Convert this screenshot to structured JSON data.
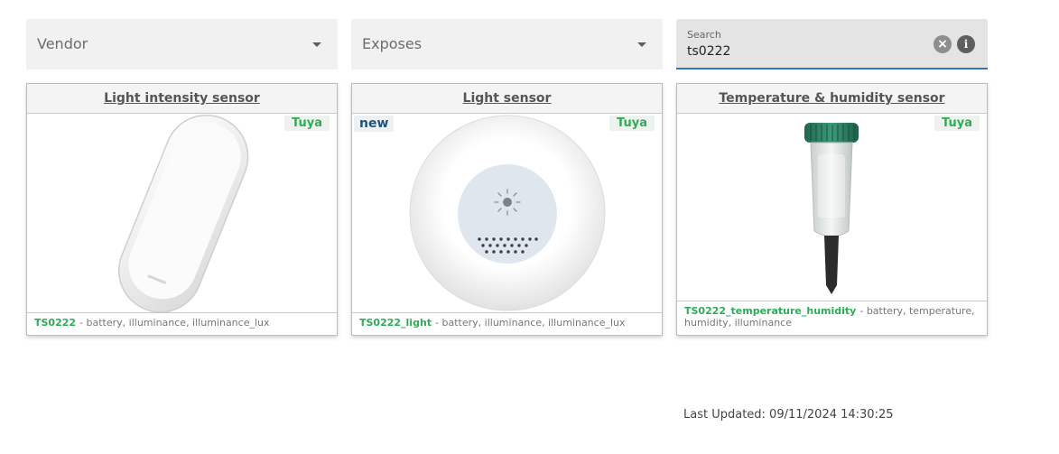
{
  "filters": {
    "vendor_label": "Vendor",
    "exposes_label": "Exposes"
  },
  "search": {
    "label": "Search",
    "value": "ts0222",
    "clear_glyph": "×",
    "info_glyph": "i"
  },
  "cards": [
    {
      "title": "Light intensity sensor",
      "vendor": "Tuya",
      "model": "TS0222",
      "exposes": "- battery, illuminance, illuminance_lux"
    },
    {
      "title": "Light sensor",
      "badge": "new",
      "vendor": "Tuya",
      "model": "TS0222_light",
      "exposes": "- battery, illuminance, illuminance_lux"
    },
    {
      "title": "Temperature & humidity sensor",
      "vendor": "Tuya",
      "model": "TS0222_temperature_humidity",
      "exposes": "- battery, temperature, humidity, illuminance"
    }
  ],
  "last_updated": "Last Updated: 09/11/2024 14:30:25",
  "colors": {
    "vendor_green": "#2eac57",
    "new_blue": "#21527f",
    "focus_blue": "#2f74c0"
  }
}
